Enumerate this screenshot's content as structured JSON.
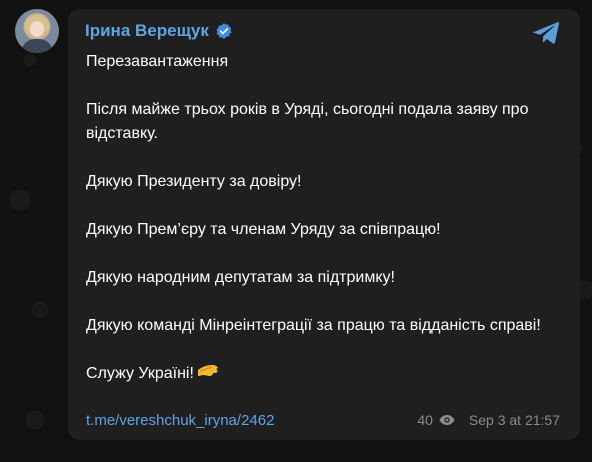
{
  "post": {
    "author": "Ірина Верещук",
    "paragraphs": [
      "Перезавантаження",
      "Після майже трьох років в Уряді, сьогодні подала заяву про відставку.",
      "Дякую Президенту за довіру!",
      "Дякую Прем’єру та членам Уряду за співпрацю!",
      "Дякую народним депутатам за підтримку!",
      "Дякую команді Мінреінтеграції за працю та відданість справі!",
      "Служу Україні!"
    ],
    "link": "t.me/vereshchuk_iryna/2462",
    "views": "40",
    "date": "Sep 3 at 21:57"
  },
  "colors": {
    "accent": "#5ea5e4",
    "bubble": "#1f1f20",
    "meta": "#8b8b8b"
  },
  "icons": {
    "verified": "verified-badge-icon",
    "app": "telegram-icon",
    "views": "eye-icon",
    "emoji": "saluting-hand-emoji"
  }
}
